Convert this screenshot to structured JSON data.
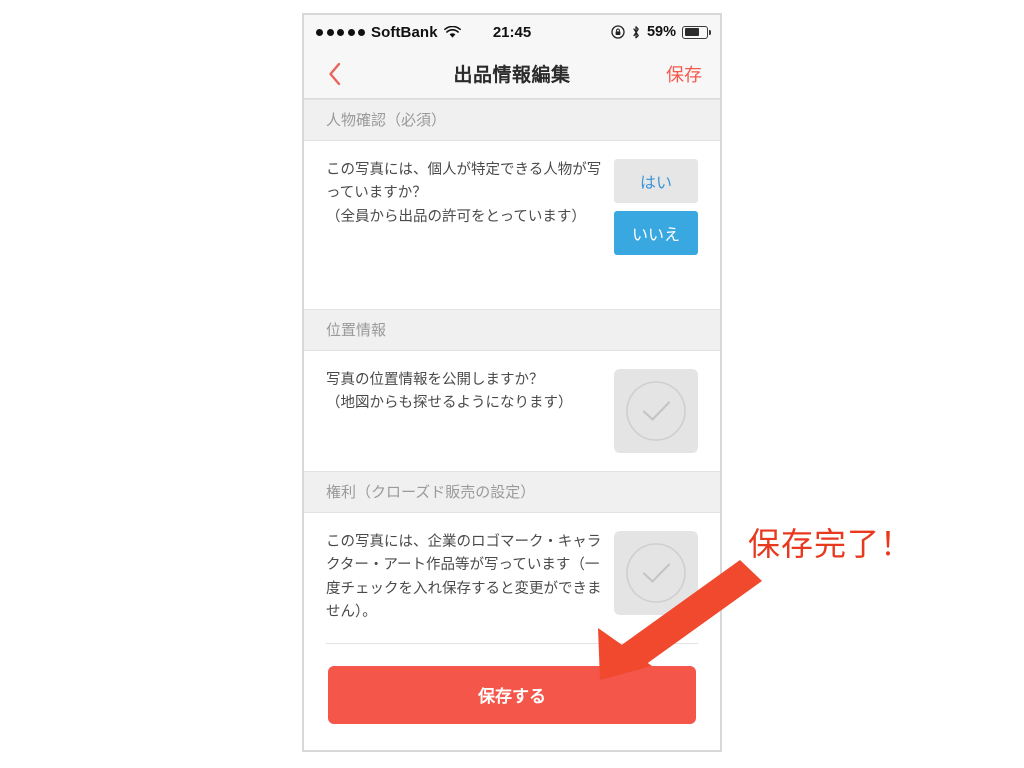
{
  "status_bar": {
    "signal_dots": 5,
    "carrier": "SoftBank",
    "wifi_icon": "wifi-icon",
    "time": "21:45",
    "rotation_lock_icon": "rotation-lock-icon",
    "bluetooth_icon": "bluetooth-icon",
    "battery_percent": "59%",
    "battery_level": 59
  },
  "nav_bar": {
    "back_icon": "chevron-left-icon",
    "title": "出品情報編集",
    "save_label": "保存",
    "accent_color": "#f4594c"
  },
  "sections": [
    {
      "header": "人物確認（必須）",
      "question": "この写真には、個人が特定できる人物が写っていますか？\n（全員から出品の許可をとっています）",
      "control": "choice",
      "options": [
        {
          "label": "はい",
          "selected": false
        },
        {
          "label": "いいえ",
          "selected": true
        }
      ]
    },
    {
      "header": "位置情報",
      "question": "写真の位置情報を公開しますか？\n（地図からも探せるようになります）",
      "control": "checkbox",
      "checkbox_icon": "check-circle-icon",
      "checked": false
    },
    {
      "header": "権利（クローズド販売の設定）",
      "question": "この写真には、企業のロゴマーク・キャラクター・アート作品等が写っています（一度チェックを入れ保存すると変更ができません）。",
      "control": "checkbox",
      "checkbox_icon": "check-circle-icon",
      "checked": false
    }
  ],
  "footer": {
    "save_button_label": "保存する",
    "save_button_color": "#f4564a"
  },
  "annotation": {
    "label": "保存完了！",
    "color": "#e8391f",
    "arrow_icon": "arrow-down-left-icon"
  },
  "colors": {
    "selected_blue": "#39a8e0",
    "unselected_blue_text": "#3d96d8",
    "section_header_bg": "#f0f0f0",
    "section_header_text": "#9a9a9a"
  }
}
